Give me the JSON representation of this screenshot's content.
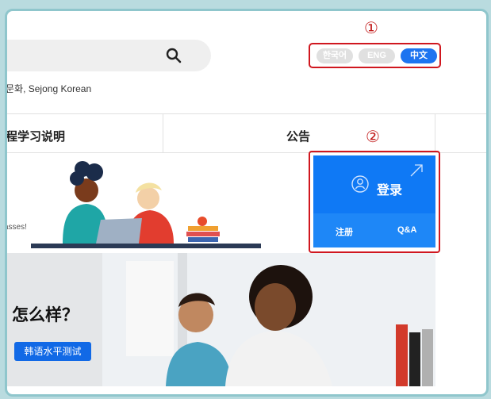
{
  "header": {
    "search_placeholder": "",
    "subtitle": "문화, Sejong Korean"
  },
  "languages": [
    {
      "label": "한국어",
      "active": false
    },
    {
      "label": "ENG",
      "active": false
    },
    {
      "label": "中文",
      "active": true
    }
  ],
  "markers": {
    "one": "①",
    "two": "②"
  },
  "nav": {
    "item1": "程学习说明",
    "item2": "公告"
  },
  "banner": {
    "text": "asses!"
  },
  "login": {
    "label": "登录",
    "register": "注册",
    "qa": "Q&A"
  },
  "promo": {
    "heading": "怎么样？",
    "button": "韩语水平测试"
  },
  "colors": {
    "accent": "#1d74f0",
    "highlight": "#d0171f",
    "login_bg": "#0f79f5"
  }
}
